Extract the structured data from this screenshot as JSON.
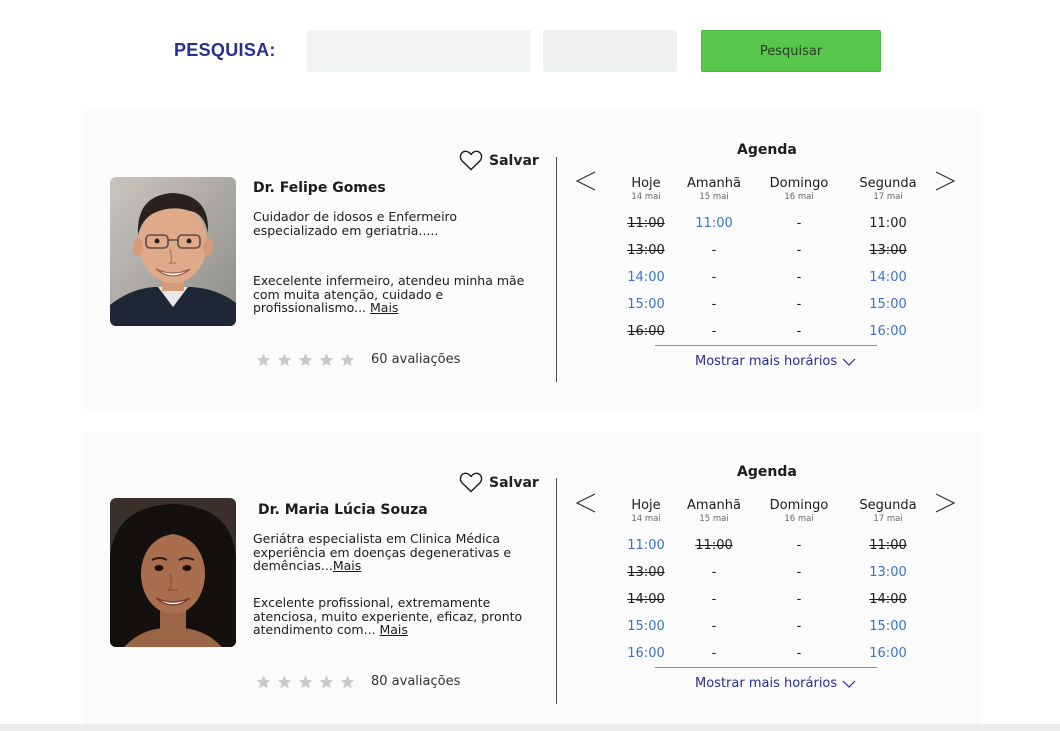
{
  "search": {
    "label": "PESQUISA:",
    "input1_value": "",
    "input2_value": "",
    "button_label": "Pesquisar"
  },
  "colors": {
    "brand_navy": "#2a2f8f",
    "button_green": "#57c84b",
    "available_blue": "#3b73c7"
  },
  "icons": {
    "save": "heart-outline-icon",
    "rating": "star-icon",
    "prev": "chevron-left-icon",
    "next": "chevron-right-icon",
    "expand": "chevron-down-icon"
  },
  "professionals": [
    {
      "save_label": "Salvar",
      "name": "Dr. Felipe Gomes",
      "description": "Cuidador de idosos e Enfermeiro especializado em geriatria.....",
      "description_more": "",
      "review": "Execelente infermeiro, atendeu minha mãe  com muita atenção, cuidado e profissionalismo... ",
      "review_more": "Mais",
      "rating_count": "60 avaliações",
      "agenda": {
        "title": "Agenda",
        "days": [
          {
            "name": "Hoje",
            "date": "14 mai"
          },
          {
            "name": "Amanhã",
            "date": "15 mai"
          },
          {
            "name": "Domingo",
            "date": "16 mai"
          },
          {
            "name": "Segunda",
            "date": "17 mai"
          }
        ],
        "slots": [
          [
            {
              "text": "11:00",
              "state": "taken"
            },
            {
              "text": "11:00",
              "state": "available"
            },
            {
              "text": "-",
              "state": "empty"
            },
            {
              "text": "11:00",
              "state": "plain"
            }
          ],
          [
            {
              "text": "13:00",
              "state": "taken"
            },
            {
              "text": "-",
              "state": "empty"
            },
            {
              "text": "-",
              "state": "empty"
            },
            {
              "text": "13:00",
              "state": "taken"
            }
          ],
          [
            {
              "text": "14:00",
              "state": "available"
            },
            {
              "text": "-",
              "state": "empty"
            },
            {
              "text": "-",
              "state": "empty"
            },
            {
              "text": "14:00",
              "state": "available"
            }
          ],
          [
            {
              "text": "15:00",
              "state": "available"
            },
            {
              "text": "-",
              "state": "empty"
            },
            {
              "text": "-",
              "state": "empty"
            },
            {
              "text": "15:00",
              "state": "available"
            }
          ],
          [
            {
              "text": "16:00",
              "state": "taken"
            },
            {
              "text": "-",
              "state": "empty"
            },
            {
              "text": "-",
              "state": "empty"
            },
            {
              "text": "16:00",
              "state": "available"
            }
          ]
        ],
        "show_more_label": "Mostrar mais horários"
      }
    },
    {
      "save_label": "Salvar",
      "name": "Dr. Maria Lúcia Souza",
      "description": "Geriátra especialista em Clinica Médica experiência em doenças degenerativas e demências...",
      "description_more": "Mais",
      "review": "Excelente profissional, extremamente atenciosa, muito experiente, eficaz, pronto atendimento com... ",
      "review_more": "Mais",
      "rating_count": "80 avaliações",
      "agenda": {
        "title": "Agenda",
        "days": [
          {
            "name": "Hoje",
            "date": "14 mai"
          },
          {
            "name": "Amanhã",
            "date": "15 mai"
          },
          {
            "name": "Domingo",
            "date": "16 mai"
          },
          {
            "name": "Segunda",
            "date": "17 mai"
          }
        ],
        "slots": [
          [
            {
              "text": "11:00",
              "state": "available"
            },
            {
              "text": "11:00",
              "state": "taken"
            },
            {
              "text": "-",
              "state": "empty"
            },
            {
              "text": "11:00",
              "state": "taken"
            }
          ],
          [
            {
              "text": "13:00",
              "state": "taken"
            },
            {
              "text": "-",
              "state": "empty"
            },
            {
              "text": "-",
              "state": "empty"
            },
            {
              "text": "13:00",
              "state": "available"
            }
          ],
          [
            {
              "text": "14:00",
              "state": "taken"
            },
            {
              "text": "-",
              "state": "empty"
            },
            {
              "text": "-",
              "state": "empty"
            },
            {
              "text": "14:00",
              "state": "taken"
            }
          ],
          [
            {
              "text": "15:00",
              "state": "available"
            },
            {
              "text": "-",
              "state": "empty"
            },
            {
              "text": "-",
              "state": "empty"
            },
            {
              "text": "15:00",
              "state": "available"
            }
          ],
          [
            {
              "text": "16:00",
              "state": "available"
            },
            {
              "text": "-",
              "state": "empty"
            },
            {
              "text": "-",
              "state": "empty"
            },
            {
              "text": "16:00",
              "state": "available"
            }
          ]
        ],
        "show_more_label": "Mostrar mais horários"
      }
    }
  ]
}
